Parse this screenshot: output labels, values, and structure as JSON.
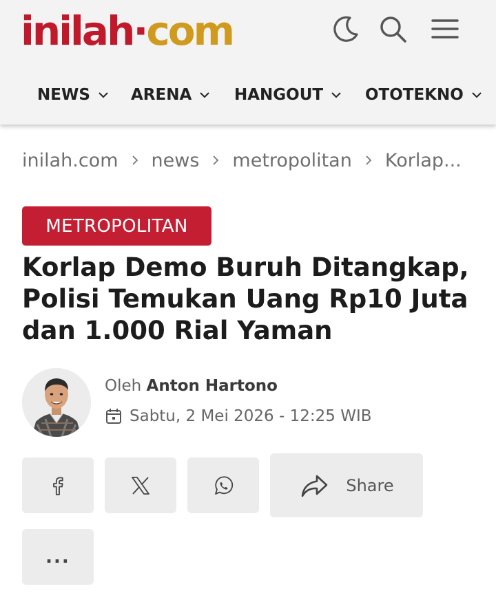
{
  "header": {
    "logo_part1": "inilah",
    "logo_part2": "com",
    "icons": [
      "moon-icon",
      "search-icon",
      "menu-icon"
    ]
  },
  "nav": {
    "items": [
      {
        "label": "NEWS"
      },
      {
        "label": "ARENA"
      },
      {
        "label": "HANGOUT"
      },
      {
        "label": "OTOTEKNO"
      }
    ]
  },
  "breadcrumb": {
    "items": [
      "inilah.com",
      "news",
      "metropolitan",
      "Korlap..."
    ]
  },
  "article": {
    "category": "METROPOLITAN",
    "title": "Korlap Demo Buruh Ditangkap, Polisi Temukan Uang Rp10 Juta dan 1.000 Rial Yaman",
    "byline_prefix": "Oleh",
    "author": "Anton Hartono",
    "date": "Sabtu, 2 Mei 2026 - 12:25 WIB"
  },
  "share": {
    "label": "Share",
    "more_label": "...",
    "buttons": [
      "facebook-icon",
      "x-icon",
      "whatsapp-icon",
      "share-arrow-icon"
    ]
  },
  "colors": {
    "brand_red": "#c0192c",
    "brand_gold": "#d09a1e",
    "badge_red": "#c41e32",
    "header_bg": "#f3f3f3",
    "button_bg": "#ececec"
  }
}
